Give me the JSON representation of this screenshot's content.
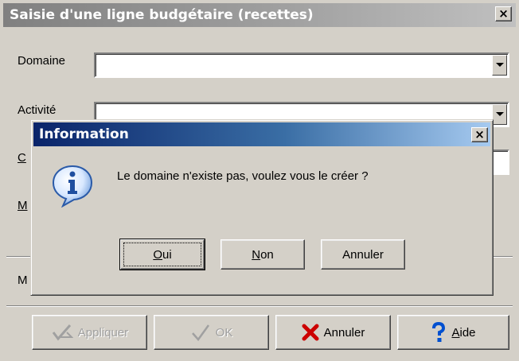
{
  "main": {
    "title": "Saisie d'une ligne budgétaire (recettes)",
    "close_glyph": "×",
    "fields": {
      "domaine": {
        "label": "Domaine",
        "value": ""
      },
      "activite": {
        "label": "Activité",
        "value": ""
      },
      "c_label_partial": "C",
      "m_label_partial_1": "M",
      "m_label_partial_2": "M"
    },
    "buttons": {
      "appliquer": {
        "label": "Appliquer",
        "icon": "apply-icon",
        "enabled": false
      },
      "ok": {
        "label": "OK",
        "icon": "checkmark-icon",
        "enabled": false
      },
      "annuler": {
        "label": "Annuler",
        "icon": "red-x-icon",
        "enabled": true
      },
      "aide": {
        "label_first": "A",
        "label_rest": "ide",
        "icon": "help-question-icon",
        "enabled": true
      }
    }
  },
  "dialog": {
    "title": "Information",
    "close_glyph": "×",
    "icon": "info-icon",
    "message": "Le domaine n'existe pas, voulez vous le créer ?",
    "buttons": {
      "oui": {
        "label_first": "O",
        "label_rest": "ui",
        "focused": true
      },
      "non": {
        "label_first": "N",
        "label_rest": "on"
      },
      "annuler": {
        "label": "Annuler"
      }
    }
  },
  "colors": {
    "dialog_titlebar_start": "#0a246a",
    "dialog_titlebar_end": "#a6caf0",
    "main_titlebar_inactive": "#808080",
    "annuler_icon": "#cc0000",
    "aide_icon": "#0050d0"
  }
}
